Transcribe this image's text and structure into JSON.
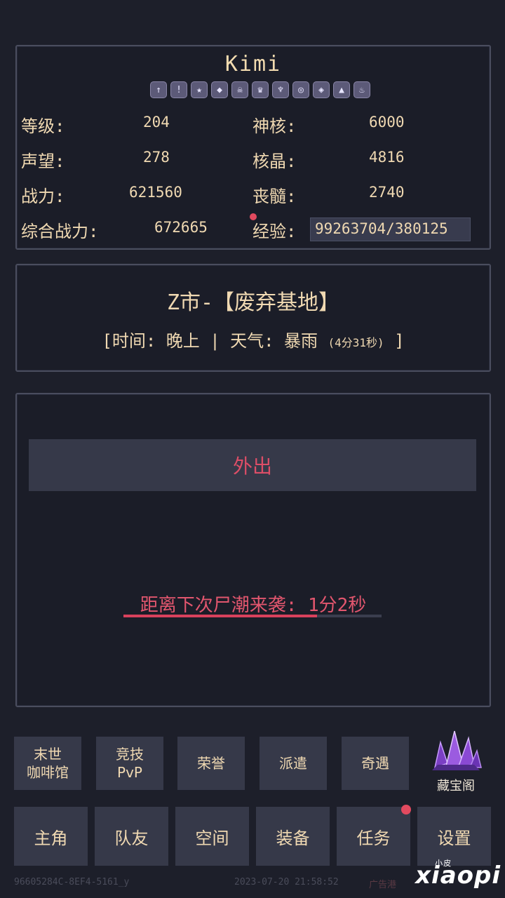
{
  "profile": {
    "name": "Kimi",
    "badge_icons": [
      "up-arrow-icon",
      "exclamation-icon",
      "star-icon",
      "shield-icon",
      "skull-icon",
      "crown-icon",
      "wings-icon",
      "spiral-icon",
      "diamond-icon",
      "helmet-icon",
      "flame-icon"
    ],
    "stats": [
      {
        "label": "等级:",
        "value": "204"
      },
      {
        "label": "神核:",
        "value": "6000"
      },
      {
        "label": "声望:",
        "value": "278"
      },
      {
        "label": "核晶:",
        "value": "4816"
      },
      {
        "label": "战力:",
        "value": "621560"
      },
      {
        "label": "丧髓:",
        "value": "2740"
      },
      {
        "label": "综合战力:",
        "value": "672665"
      },
      {
        "label": "经验:",
        "value": "99263704/380125"
      }
    ]
  },
  "location": {
    "title": "Z市-【废弃基地】",
    "info_prefix": "[时间: 晚上 | 天气: 暴雨",
    "info_timer": "(4分31秒)",
    "info_suffix": "]"
  },
  "action": {
    "out_button": "外出",
    "wave_text": "距离下次尸潮来袭: 1分2秒",
    "wave_progress": 0.75
  },
  "features": {
    "cafe": [
      "末世",
      "咖啡馆"
    ],
    "arena": [
      "竞技",
      "PvP"
    ],
    "honor": "荣誉",
    "dispatch": "派遣",
    "encounter": "奇遇",
    "treasure": "藏宝阁"
  },
  "nav": [
    "主角",
    "队友",
    "空间",
    "装备",
    "任务",
    "设置"
  ],
  "footer": {
    "id": "96605284C-8EF4-5161_y",
    "datetime": "2023-07-20 21:58:52",
    "ad": "广告港"
  },
  "watermark": {
    "small": "小皮",
    "big": "xiaopi"
  },
  "colors": {
    "accent_red": "#dd4e67",
    "text_gold": "#f0d9b2",
    "panel_bg": "#1b1d28",
    "button_bg": "#363949"
  }
}
